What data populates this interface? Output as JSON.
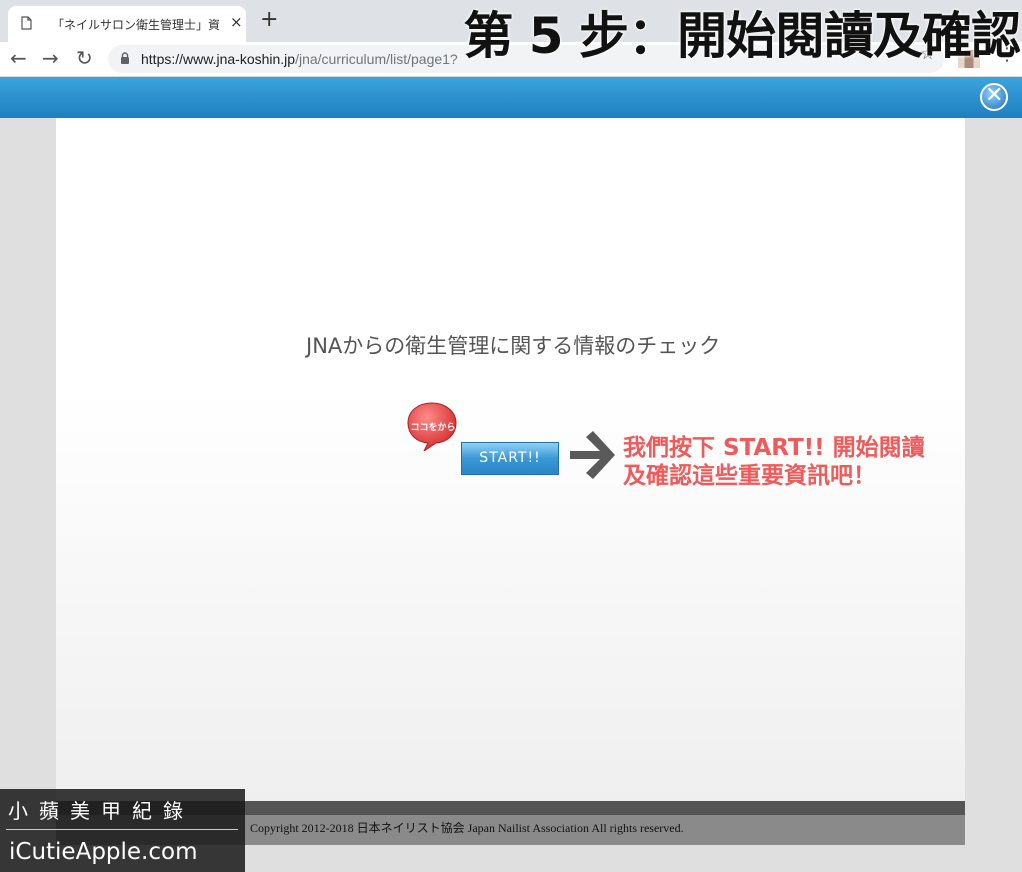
{
  "browser": {
    "tab_title": "「ネイルサロン衛生管理士」資格",
    "tab_close": "×",
    "new_tab": "+",
    "url_host": "https://www.jna-koshin.jp",
    "url_path": "/jna/curriculum/list/page1?",
    "back": "←",
    "forward": "→",
    "reload": "↻",
    "star": "☆",
    "menu": "⋮"
  },
  "overlay": {
    "step_title": "第 5 步：開始閱讀及確認"
  },
  "modal": {
    "close_label": "✕",
    "heading": "JNAからの衛生管理に関する情報のチェック",
    "badge_label": "ココをから",
    "start_label": "START!!",
    "annotation_line1": "我們按下 START!! 開始閱讀",
    "annotation_line2": "及確認這些重要資訊吧！",
    "copyright": "Copyright 2012-2018 日本ネイリスト協会 Japan Nailist Association All rights reserved."
  },
  "watermark": {
    "chinese": "小蘋美甲紀錄",
    "domain": "iCutieApple.com"
  },
  "colors": {
    "bar_blue": "#2a8fd0",
    "annotation_red": "#ef5a5a",
    "badge_red": "#e23b3b"
  }
}
